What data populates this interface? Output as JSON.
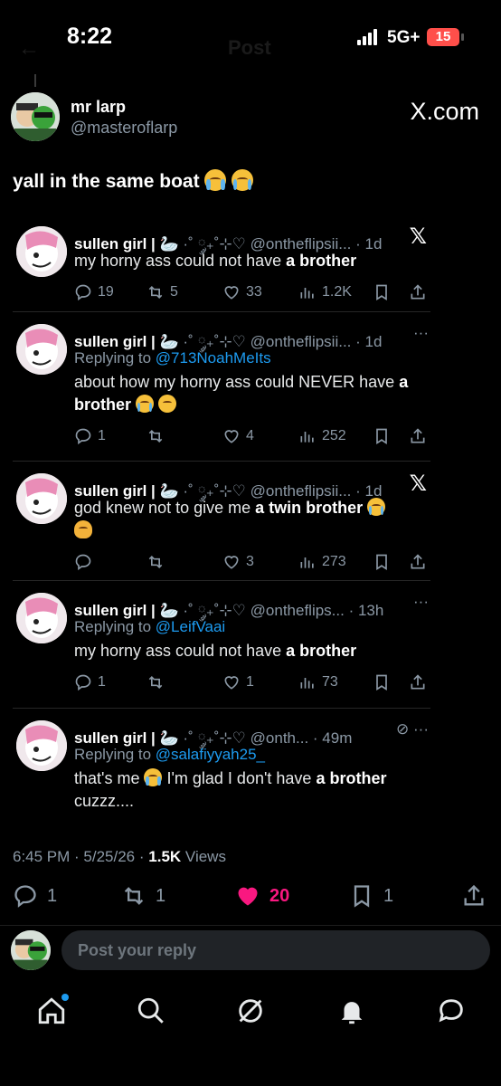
{
  "status_bar": {
    "time": "8:22",
    "network": "5G+",
    "battery": "15",
    "ghost_title": "Post",
    "ghost_back": "←"
  },
  "quote_post": {
    "author_name": "mr larp",
    "author_handle": "@masteroflarp",
    "watermark": "X.com",
    "text": "yall in the same boat",
    "text_emojis": [
      "loudly-crying-face",
      "loudly-crying-face"
    ]
  },
  "replies": [
    {
      "name": "sullen girl |",
      "name_decor": "🦢 ·˚ ༘₊˚⊹♡",
      "handle": "@ontheflipsii...",
      "time": "· 1d",
      "corner": "𝕏",
      "replying_label": "",
      "replying_to": "",
      "text_before": "my horny ass could not have ",
      "text_bold": "a brother",
      "text_after": "",
      "emojis": [],
      "replies": "19",
      "reposts": "5",
      "likes": "33",
      "views": "1.2K"
    },
    {
      "name": "sullen girl |",
      "name_decor": "🦢 ·˚ ༘₊˚⊹♡",
      "handle": "@ontheflipsii...",
      "time": "· 1d",
      "corner": "···",
      "replying_label": "Replying to ",
      "replying_to": "@713NoahMeIts",
      "text_before": "about how my horny ass could NEVER have ",
      "text_bold": "a brother",
      "text_after": "",
      "emojis": [
        "loudly-crying-face",
        "grinning-face"
      ],
      "replies": "1",
      "reposts": "",
      "likes": "4",
      "views": "252"
    },
    {
      "name": "sullen girl |",
      "name_decor": "🦢 ·˚ ༘₊˚⊹♡",
      "handle": "@ontheflipsii...",
      "time": "· 1d",
      "corner": "𝕏",
      "replying_label": "",
      "replying_to": "",
      "text_before": "god knew not to give me ",
      "text_bold": "a twin brother",
      "text_after": "",
      "emojis": [
        "tears-of-joy-face",
        "woman-facepalming"
      ],
      "replies": "",
      "reposts": "",
      "likes": "3",
      "views": "273"
    },
    {
      "name": "sullen girl |",
      "name_decor": "🦢 ·˚ ༘₊˚⊹♡",
      "handle": "@ontheflips...",
      "time": "· 13h",
      "corner": "···",
      "replying_label": "Replying to ",
      "replying_to": "@LeifVaai",
      "text_before": "my horny ass could not have ",
      "text_bold": "a brother",
      "text_after": "",
      "emojis": [],
      "replies": "1",
      "reposts": "",
      "likes": "1",
      "views": "73"
    },
    {
      "name": "sullen girl |",
      "name_decor": "🦢 ·˚ ༘₊˚⊹♡",
      "handle": "@onth...",
      "time": "· 49m",
      "corner": "⊘ ···",
      "replying_label": "Replying to ",
      "replying_to": "@salafiyyah25_",
      "text_before": "that's me ",
      "text_mid": " I'm glad I don't have ",
      "text_bold": "a brother",
      "text_after": " cuzzz....",
      "emojis": [
        "loudly-crying-face"
      ]
    }
  ],
  "post_meta": {
    "time": "6:45 PM",
    "sep1": " · ",
    "date": "5/25/26",
    "sep2": " · ",
    "views_count": "1.5K",
    "views_label": " Views"
  },
  "post_stats": {
    "replies": "1",
    "reposts": "1",
    "likes": "20",
    "bookmarks": "1",
    "accent_like": "#f91880"
  },
  "composer": {
    "placeholder": "Post your reply"
  },
  "tabbar": {
    "items": [
      "home-icon",
      "search-icon",
      "grok-icon",
      "notifications-icon",
      "messages-icon"
    ]
  }
}
